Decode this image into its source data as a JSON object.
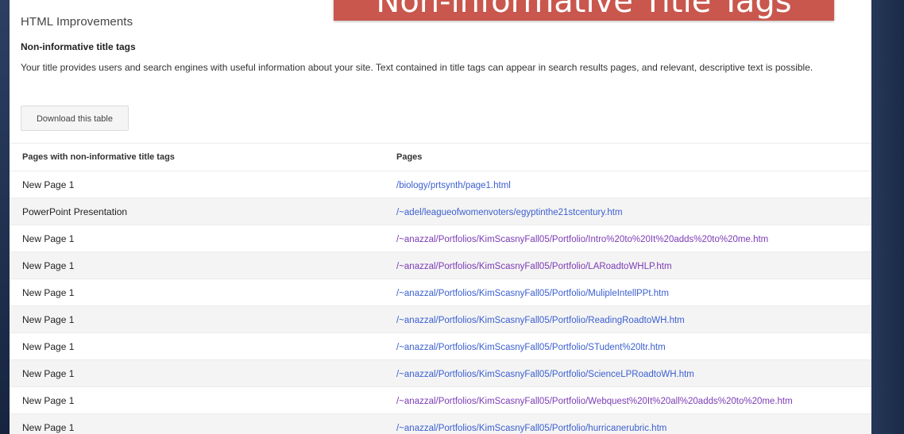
{
  "slide_title": "Non-informative Title Tags",
  "app_title": "HTML Improvements",
  "section": {
    "heading": "Non-informative title tags",
    "description": "Your title provides users and search engines with useful information about your site. Text contained in title tags can appear in search results pages, and relevant, descriptive text is possible.",
    "download_label": "Download this table"
  },
  "table": {
    "columns": [
      "Pages with non-informative title tags",
      "Pages"
    ],
    "rows": [
      {
        "title": "New Page 1",
        "page": "/biology/prtsynth/page1.html"
      },
      {
        "title": "PowerPoint Presentation",
        "page": "/~adel/leagueofwomenvoters/egyptinthe21stcentury.htm"
      },
      {
        "title": "New Page 1",
        "page": "/~anazzal/Portfolios/KimScasnyFall05/Portfolio/Intro%20to%20It%20adds%20to%20me.htm"
      },
      {
        "title": "New Page 1",
        "page": "/~anazzal/Portfolios/KimScasnyFall05/Portfolio/LARoadtoWHLP.htm"
      },
      {
        "title": "New Page 1",
        "page": "/~anazzal/Portfolios/KimScasnyFall05/Portfolio/MulipleIntellPPt.htm"
      },
      {
        "title": "New Page 1",
        "page": "/~anazzal/Portfolios/KimScasnyFall05/Portfolio/ReadingRoadtoWH.htm"
      },
      {
        "title": "New Page 1",
        "page": "/~anazzal/Portfolios/KimScasnyFall05/Portfolio/STudent%20ltr.htm"
      },
      {
        "title": "New Page 1",
        "page": "/~anazzal/Portfolios/KimScasnyFall05/Portfolio/ScienceLPRoadtoWH.htm"
      },
      {
        "title": "New Page 1",
        "page": "/~anazzal/Portfolios/KimScasnyFall05/Portfolio/Webquest%20It%20all%20adds%20to%20me.htm"
      },
      {
        "title": "New Page 1",
        "page": "/~anazzal/Portfolios/KimScasnyFall05/Portfolio/hurricanerubric.htm"
      }
    ]
  },
  "colors": {
    "link": "#3b5fd1",
    "visited_link": "#7c3bb5",
    "slide_banner": "#c9574d",
    "slide_background": "#1e2f4d"
  }
}
